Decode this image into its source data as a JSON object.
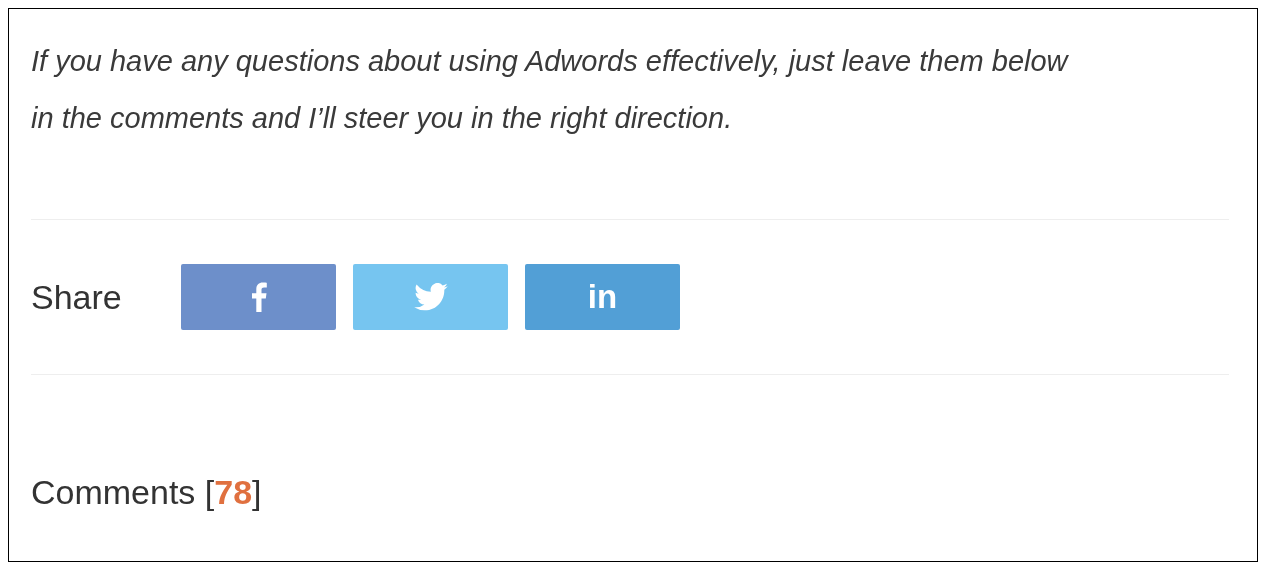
{
  "intro": "If you have any questions about using Adwords effectively, just leave them below in the comments and I’ll steer you in the right direction.",
  "share": {
    "label": "Share",
    "buttons": [
      {
        "kind": "facebook"
      },
      {
        "kind": "twitter"
      },
      {
        "kind": "linkedin",
        "label": "in"
      }
    ]
  },
  "comments": "Comments [**78**]"
}
